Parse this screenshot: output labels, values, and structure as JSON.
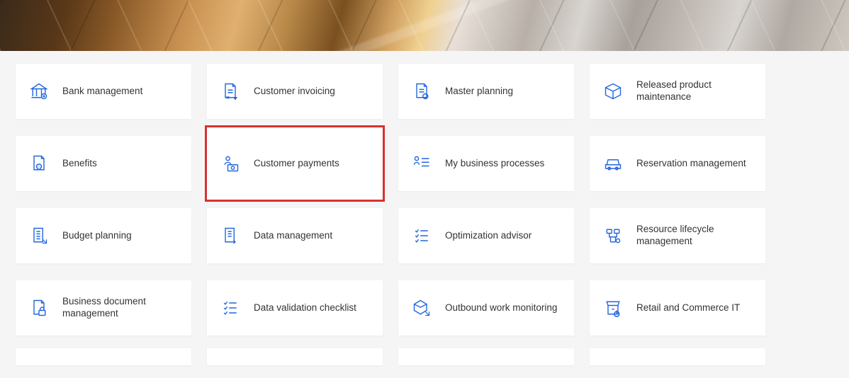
{
  "accent": "#2266dd",
  "highlight_border": "#d93030",
  "tiles": {
    "bank_management": "Bank management",
    "customer_invoicing": "Customer invoicing",
    "master_planning": "Master planning",
    "released_product_maintenance": "Released product maintenance",
    "benefits": "Benefits",
    "customer_payments": "Customer payments",
    "my_business_processes": "My business processes",
    "reservation_management": "Reservation management",
    "budget_planning": "Budget planning",
    "data_management": "Data management",
    "optimization_advisor": "Optimization advisor",
    "resource_lifecycle_management": "Resource lifecycle management",
    "business_document_management": "Business document management",
    "data_validation_checklist": "Data validation checklist",
    "outbound_work_monitoring": "Outbound work monitoring",
    "retail_and_commerce_it": "Retail and Commerce IT"
  }
}
